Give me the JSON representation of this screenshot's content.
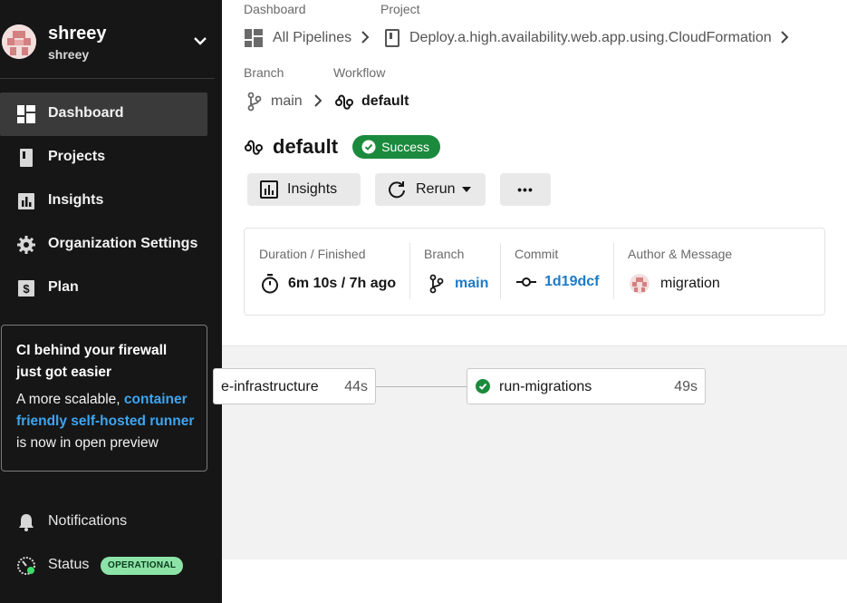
{
  "user": {
    "name": "shreey",
    "handle": "shreey"
  },
  "nav": [
    {
      "label": "Dashboard",
      "icon": "dashboard-icon",
      "active": true
    },
    {
      "label": "Projects",
      "icon": "projects-icon"
    },
    {
      "label": "Insights",
      "icon": "insights-icon"
    },
    {
      "label": "Organization Settings",
      "icon": "gear-icon"
    },
    {
      "label": "Plan",
      "icon": "dollar-icon"
    }
  ],
  "promo": {
    "title": "CI behind your firewall just got easier",
    "body_prefix": "A more scalable, ",
    "link": "container friendly self-hosted runner",
    "body_suffix": " is now in open preview"
  },
  "footer": {
    "notifications": "Notifications",
    "status": "Status",
    "status_badge": "OPERATIONAL"
  },
  "breadcrumb": {
    "dashboard_label": "Dashboard",
    "project_label": "Project",
    "dashboard_value": "All Pipelines",
    "project_value": "Deploy.a.high.availability.web.app.using.CloudFormation",
    "branch_label": "Branch",
    "workflow_label": "Workflow",
    "branch_value": "main",
    "workflow_value": "default"
  },
  "workflow": {
    "title": "default",
    "status": "Success"
  },
  "actions": {
    "insights": "Insights",
    "rerun": "Rerun",
    "more": "•••"
  },
  "info": {
    "duration_label": "Duration / Finished",
    "duration_value": "6m 10s / 7h ago",
    "branch_label": "Branch",
    "branch_value": "main",
    "commit_label": "Commit",
    "commit_value": "1d19dcf",
    "author_label": "Author & Message",
    "author_message": "migration"
  },
  "jobs": [
    {
      "name": "e-infrastructure",
      "duration": "44s"
    },
    {
      "name": "run-migrations",
      "duration": "49s"
    }
  ],
  "colors": {
    "sidebar_bg": "#161616",
    "success": "#1b8a3d",
    "link": "#1e7bc6",
    "status_badge": "#8de3a7"
  }
}
